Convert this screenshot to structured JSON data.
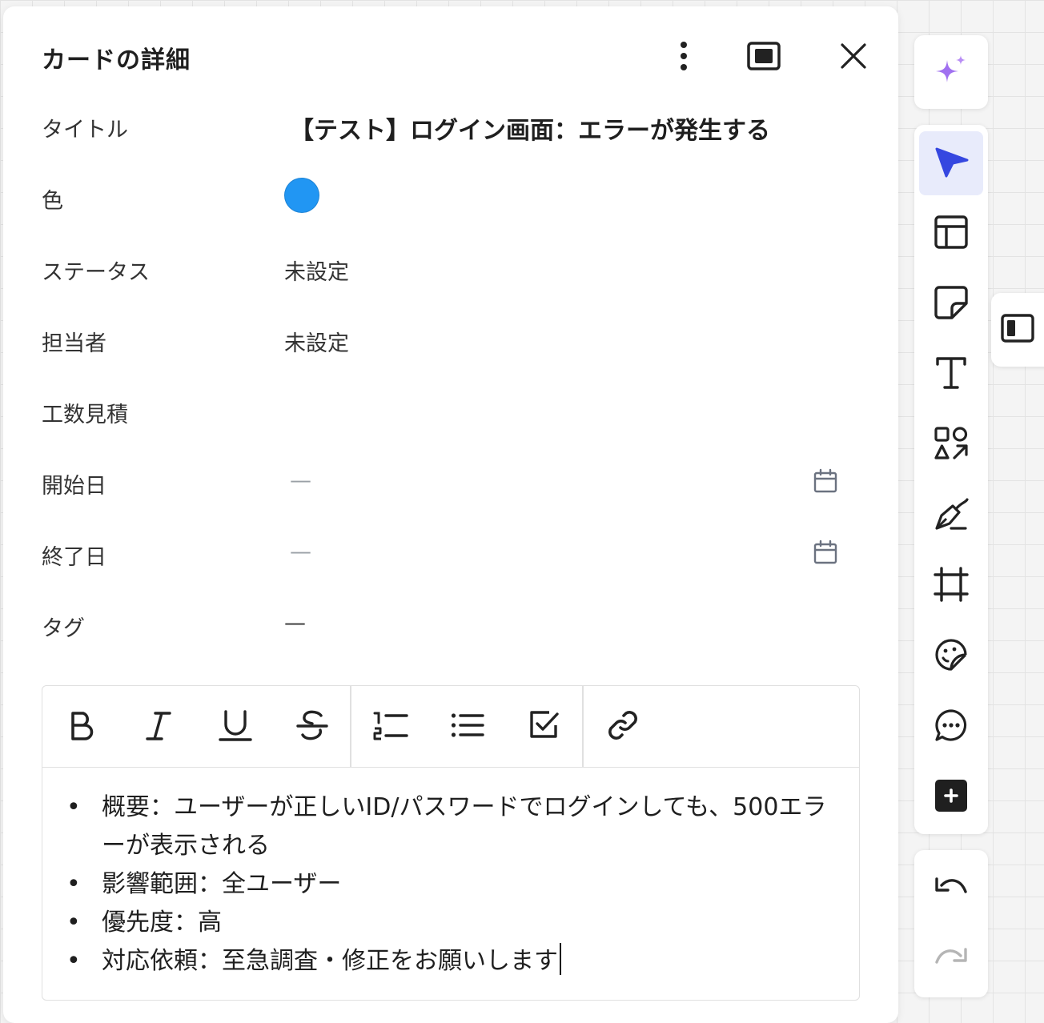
{
  "panel": {
    "title": "カードの詳細",
    "header_icons": [
      "more-vertical-icon",
      "expand-icon",
      "close-icon"
    ]
  },
  "fields": {
    "title": {
      "label": "タイトル",
      "value": "【テスト】ログイン画面：エラーが発生する"
    },
    "color": {
      "label": "色",
      "value": "#2196f3"
    },
    "status": {
      "label": "ステータス",
      "value": "未設定"
    },
    "assignee": {
      "label": "担当者",
      "value": "未設定"
    },
    "estimate": {
      "label": "工数見積",
      "value": ""
    },
    "start_date": {
      "label": "開始日",
      "value": "—"
    },
    "end_date": {
      "label": "終了日",
      "value": "—"
    },
    "tags": {
      "label": "タグ",
      "value": "—"
    }
  },
  "editor": {
    "toolbar": [
      "bold-icon",
      "italic-icon",
      "underline-icon",
      "strikethrough-icon",
      "numbered-list-icon",
      "bullet-list-icon",
      "checkbox-icon",
      "link-icon"
    ],
    "bullet": "•",
    "lines": [
      "概要：ユーザーが正しいID/パスワードでログインしても、500エラーが表示される",
      "影響範囲：全ユーザー",
      "優先度：高",
      "対応依頼：至急調査・修正をお願いします"
    ]
  },
  "right_toolbar": {
    "ai": "sparkle-icon",
    "tools": [
      "select-cursor-icon",
      "template-icon",
      "sticky-note-icon",
      "text-icon",
      "shapes-icon",
      "pen-icon",
      "frame-icon",
      "sticker-icon",
      "comment-icon",
      "add-icon"
    ],
    "history": [
      "undo-icon",
      "redo-icon"
    ],
    "sidepanel": "sidepanel-toggle-icon"
  },
  "colors": {
    "accent": "#3547e0",
    "ai_purple": "#a070f0",
    "dot_blue": "#2196f3"
  }
}
